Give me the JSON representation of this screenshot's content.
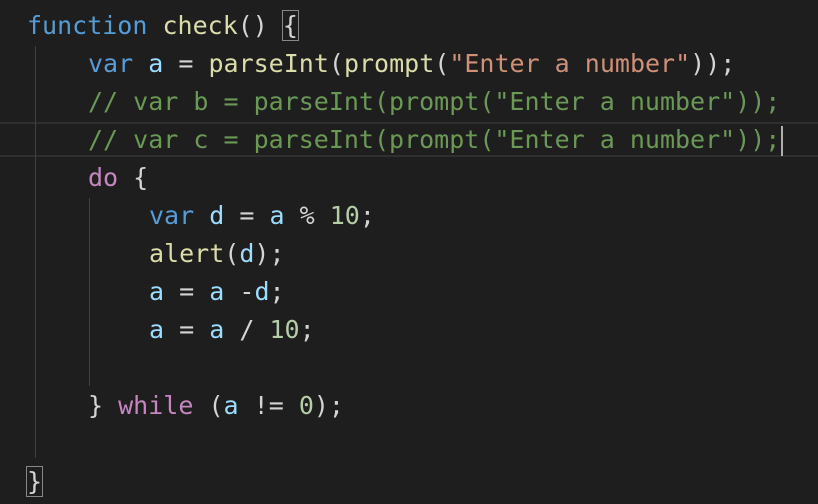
{
  "colors": {
    "background": "#1e1e1e",
    "keyword_storage": "#569cd6",
    "keyword_control": "#c586c0",
    "function": "#dcdcaa",
    "variable": "#9cdcfe",
    "string": "#ce9178",
    "number": "#b5cea8",
    "comment": "#6a9955",
    "text": "#d4d4d4"
  },
  "code": {
    "line1": {
      "kw_function": "function",
      "fn_name": "check",
      "parens": "()",
      "open_brace": "{"
    },
    "line2": {
      "kw_var": "var",
      "var_a": "a",
      "op_eq": "=",
      "fn_parseInt": "parseInt",
      "paren_open_1": "(",
      "fn_prompt": "prompt",
      "paren_open_2": "(",
      "string": "\"Enter a number\"",
      "close": "));"
    },
    "line3": {
      "comment": "// var b = parseInt(prompt(\"Enter a number\"));"
    },
    "line4": {
      "comment": "// var c = parseInt(prompt(\"Enter a number\"));"
    },
    "line5": {
      "kw_do": "do",
      "open_brace": "{"
    },
    "line6": {
      "kw_var": "var",
      "var_d": "d",
      "op_eq": "=",
      "var_a": "a",
      "op_mod": "%",
      "num": "10",
      "semi": ";"
    },
    "line7": {
      "fn_alert": "alert",
      "paren_open": "(",
      "var_d": "d",
      "close": ");"
    },
    "line8": {
      "var_a1": "a",
      "op_eq": "=",
      "var_a2": "a",
      "op_minus": "-",
      "var_d": "d",
      "semi": ";"
    },
    "line9": {
      "var_a1": "a",
      "op_eq": "=",
      "var_a2": "a",
      "op_div": "/",
      "num": "10",
      "semi": ";"
    },
    "line11": {
      "close_brace": "}",
      "kw_while": "while",
      "paren_open": "(",
      "var_a": "a",
      "op_neq": "!=",
      "num": "0",
      "close": ");"
    },
    "line13": {
      "close_brace": "}"
    }
  }
}
